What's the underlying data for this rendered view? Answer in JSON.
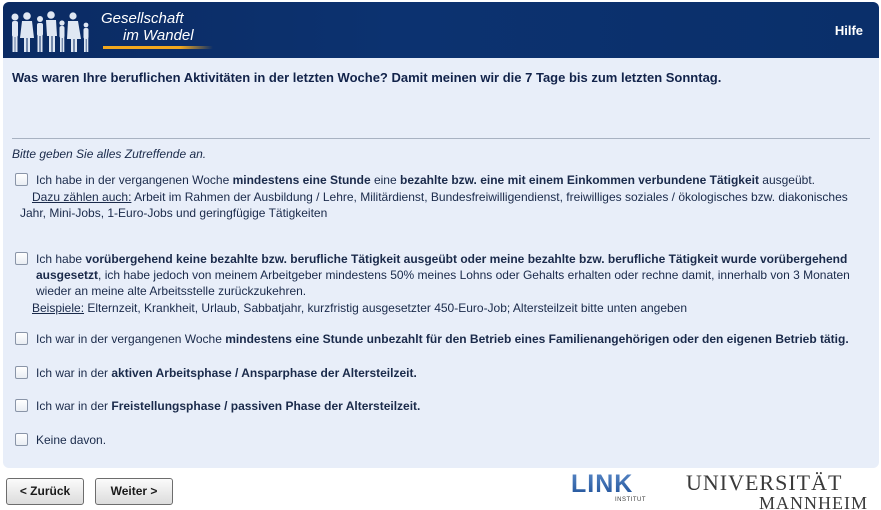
{
  "header": {
    "logo_line1": "Gesellschaft",
    "logo_line2": "im Wandel",
    "help_label": "Hilfe",
    "colors": {
      "background": "#0c3270",
      "accent": "#f2a81e"
    }
  },
  "question": "Was waren Ihre beruflichen Aktivitäten in der letzten Woche? Damit meinen wir die 7 Tage bis zum letzten Sonntag.",
  "instruction": "Bitte geben Sie alles Zutreffende an.",
  "options": [
    {
      "t1": "Ich habe in der vergangenen Woche ",
      "b1": "mindestens eine Stunde",
      "t2": " eine ",
      "b2": "bezahlte bzw. eine mit einem Einkommen verbundene Tätigkeit",
      "t3": " ausgeübt.",
      "sub_label": "Dazu zählen auch:",
      "sub_text": " Arbeit im Rahmen der Ausbildung / Lehre, Militärdienst, Bundesfreiwilligendienst, freiwilliges soziales / ökologisches bzw. diakonisches",
      "sub_text2": "Jahr, Mini-Jobs, 1-Euro-Jobs und geringfügige Tätigkeiten"
    },
    {
      "t1": "Ich habe ",
      "b1": "vorübergehend keine bezahlte bzw. berufliche Tätigkeit ausgeübt oder meine bezahlte bzw. berufliche Tätigkeit wurde vorübergehend ausgesetzt",
      "t2": ", ich habe jedoch von meinem Arbeitgeber mindestens 50% meines Lohns oder Gehalts erhalten oder rechne damit, innerhalb von 3 Monaten wieder an meine alte Arbeitsstelle zurückzukehren.",
      "sub_label": "Beispiele:",
      "sub_text": " Elternzeit, Krankheit, Urlaub, Sabbatjahr, kurzfristig ausgesetzter 450-Euro-Job; Altersteilzeit bitte unten angeben"
    },
    {
      "t1": "Ich war in der vergangenen Woche ",
      "b1": "mindestens eine Stunde unbezahlt für den Betrieb eines Familienangehörigen oder den eigenen Betrieb tätig."
    },
    {
      "t1": "Ich war in der ",
      "b1": "aktiven Arbeitsphase / Ansparphase der Altersteilzeit."
    },
    {
      "t1": "Ich war in der ",
      "b1": "Freistellungsphase / passiven Phase der Altersteilzeit."
    },
    {
      "t1": "Keine davon."
    }
  ],
  "nav": {
    "back_label": "< Zurück",
    "next_label": "Weiter >"
  },
  "footer": {
    "link_logo": "LINK",
    "link_sub": "INSTITUT",
    "uni_line1": "UNIVERSITÄT",
    "uni_line2": "MANNHEIM"
  }
}
